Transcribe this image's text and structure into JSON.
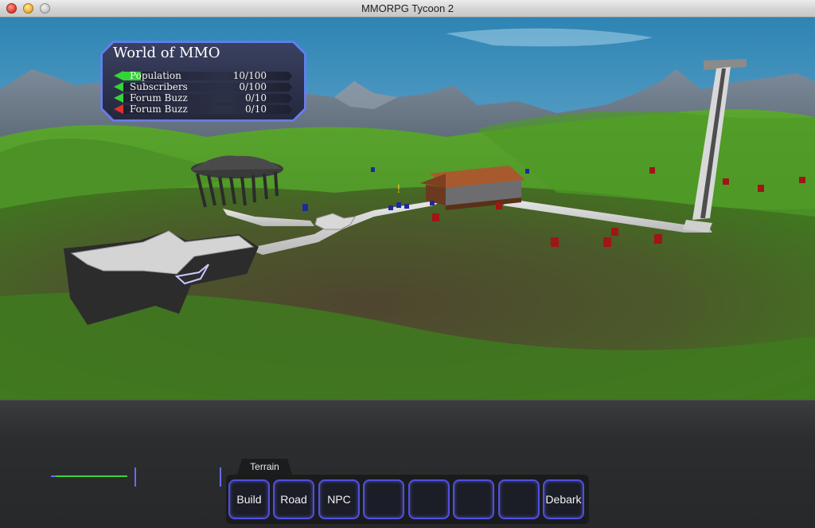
{
  "window": {
    "title": "MMORPG Tycoon 2"
  },
  "stats_panel": {
    "title": "World of MMO",
    "rows": [
      {
        "label": "Population",
        "value": "10/100",
        "trend": "up",
        "fill": 0.1,
        "color": "#35d436"
      },
      {
        "label": "Subscribers",
        "value": "0/100",
        "trend": "up",
        "fill": 0,
        "color": "#35d436"
      },
      {
        "label": "Forum Buzz",
        "value": "0/10",
        "trend": "up",
        "fill": 0,
        "color": "#35d436"
      },
      {
        "label": "Forum Buzz",
        "value": "0/10",
        "trend": "down",
        "fill": 0,
        "color": "#e23030"
      }
    ]
  },
  "toolbar": {
    "active_tab": "Terrain",
    "buttons": [
      "Build",
      "Road",
      "NPC",
      "",
      "",
      "",
      "",
      "Debark"
    ],
    "accent_color": "#4f4fe0"
  }
}
